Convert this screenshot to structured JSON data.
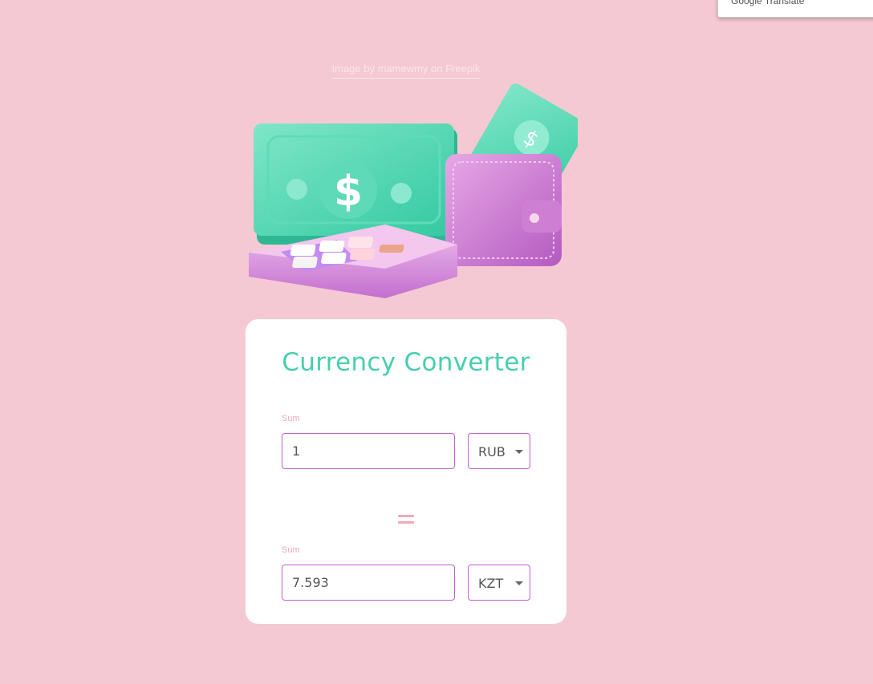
{
  "translate_popup": {
    "label": "Google Translate"
  },
  "credit": {
    "text": "Image by mamewmy on Freepik"
  },
  "converter": {
    "title": "Currency Converter",
    "from": {
      "label": "Sum",
      "value": "1",
      "currency": "RUB"
    },
    "to": {
      "label": "Sum",
      "value": "7.593",
      "currency": "KZT"
    }
  },
  "colors": {
    "background": "#f5c9d3",
    "accent": "#45cfad",
    "input_border": "#c35fc9",
    "label": "#f0a9bb"
  },
  "icons": [
    "money-wallet-calculator-illustration",
    "equals-icon",
    "chevron-down-icon"
  ]
}
